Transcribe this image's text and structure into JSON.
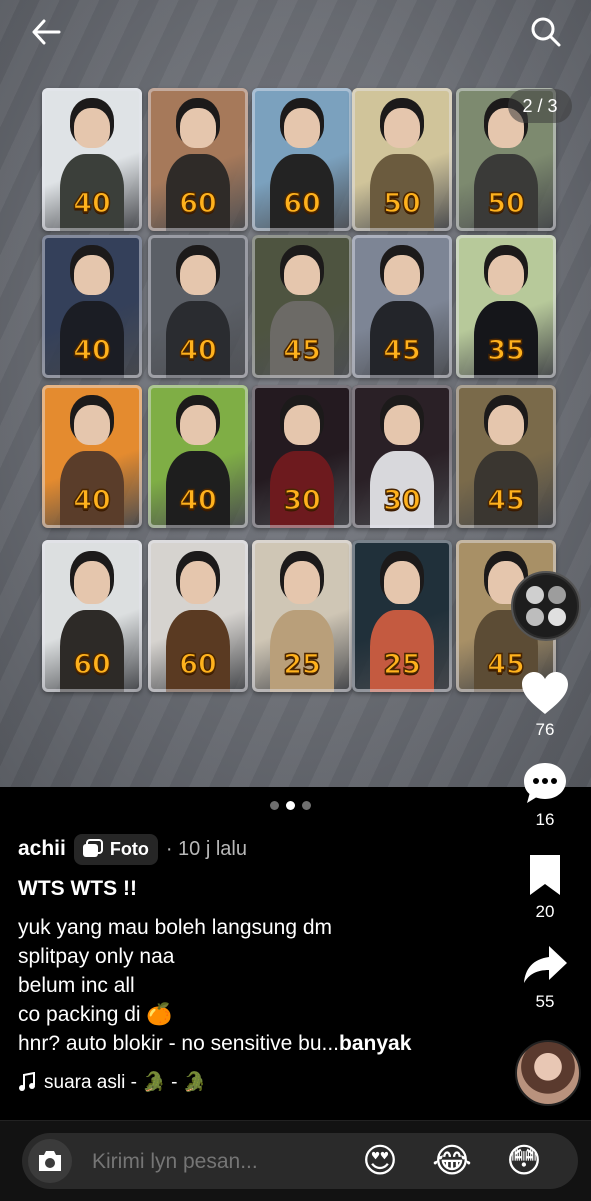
{
  "photo": {
    "counter": "2 / 3",
    "cards": [
      {
        "price": "40",
        "bg": "#dfe3e6",
        "shirt": "#3b3f3a"
      },
      {
        "price": "60",
        "bg": "#a6795a",
        "shirt": "#2f2b28"
      },
      {
        "price": "60",
        "bg": "#7ba1be",
        "shirt": "#232323"
      },
      {
        "price": "50",
        "bg": "#d0c49a",
        "shirt": "#6b5b3e"
      },
      {
        "price": "50",
        "bg": "#7d8a6f",
        "shirt": "#3a3a38"
      },
      {
        "price": "40",
        "bg": "#34405a",
        "shirt": "#1b1d24"
      },
      {
        "price": "40",
        "bg": "#5b5f66",
        "shirt": "#2a2c30"
      },
      {
        "price": "45",
        "bg": "#4e5440",
        "shirt": "#6c6a66"
      },
      {
        "price": "45",
        "bg": "#7d8595",
        "shirt": "#23252a"
      },
      {
        "price": "35",
        "bg": "#b7c99a",
        "shirt": "#15161a"
      },
      {
        "price": "40",
        "bg": "#e48b2f",
        "shirt": "#5a3d2a"
      },
      {
        "price": "40",
        "bg": "#7fae45",
        "shirt": "#1e1e1e"
      },
      {
        "price": "30",
        "bg": "#241a20",
        "shirt": "#6d1a1e"
      },
      {
        "price": "30",
        "bg": "#2a2026",
        "shirt": "#d8d8dc"
      },
      {
        "price": "45",
        "bg": "#7a6a4a",
        "shirt": "#3a3630"
      },
      {
        "price": "60",
        "bg": "#dcdfe0",
        "shirt": "#2d2a27"
      },
      {
        "price": "60",
        "bg": "#d6d3cf",
        "shirt": "#5a3a22"
      },
      {
        "price": "25",
        "bg": "#cfc6b5",
        "shirt": "#b99f7a"
      },
      {
        "price": "25",
        "bg": "#20303a",
        "shirt": "#c45a40"
      },
      {
        "price": "45",
        "bg": "#a89066",
        "shirt": "#5c4c35"
      }
    ]
  },
  "pagination": {
    "total": 3,
    "active": 1
  },
  "post": {
    "username": "achii",
    "badge": "Foto",
    "time": "· 10 j lalu",
    "title": "WTS WTS !!",
    "lines": [
      "yuk yang mau boleh langsung dm",
      "splitpay only naa",
      "belum inc all",
      "co packing di 🍊",
      "hnr? auto blokir - no sensitive bu..."
    ],
    "more": "banyak",
    "music": "suara asli - 🐊 - 🐊"
  },
  "actions": {
    "likes": "76",
    "comments": "16",
    "saves": "20",
    "shares": "55"
  },
  "comment_bar": {
    "placeholder": "Kirimi lyn pesan...",
    "emojis": [
      "😍",
      "😂",
      "😳"
    ]
  }
}
